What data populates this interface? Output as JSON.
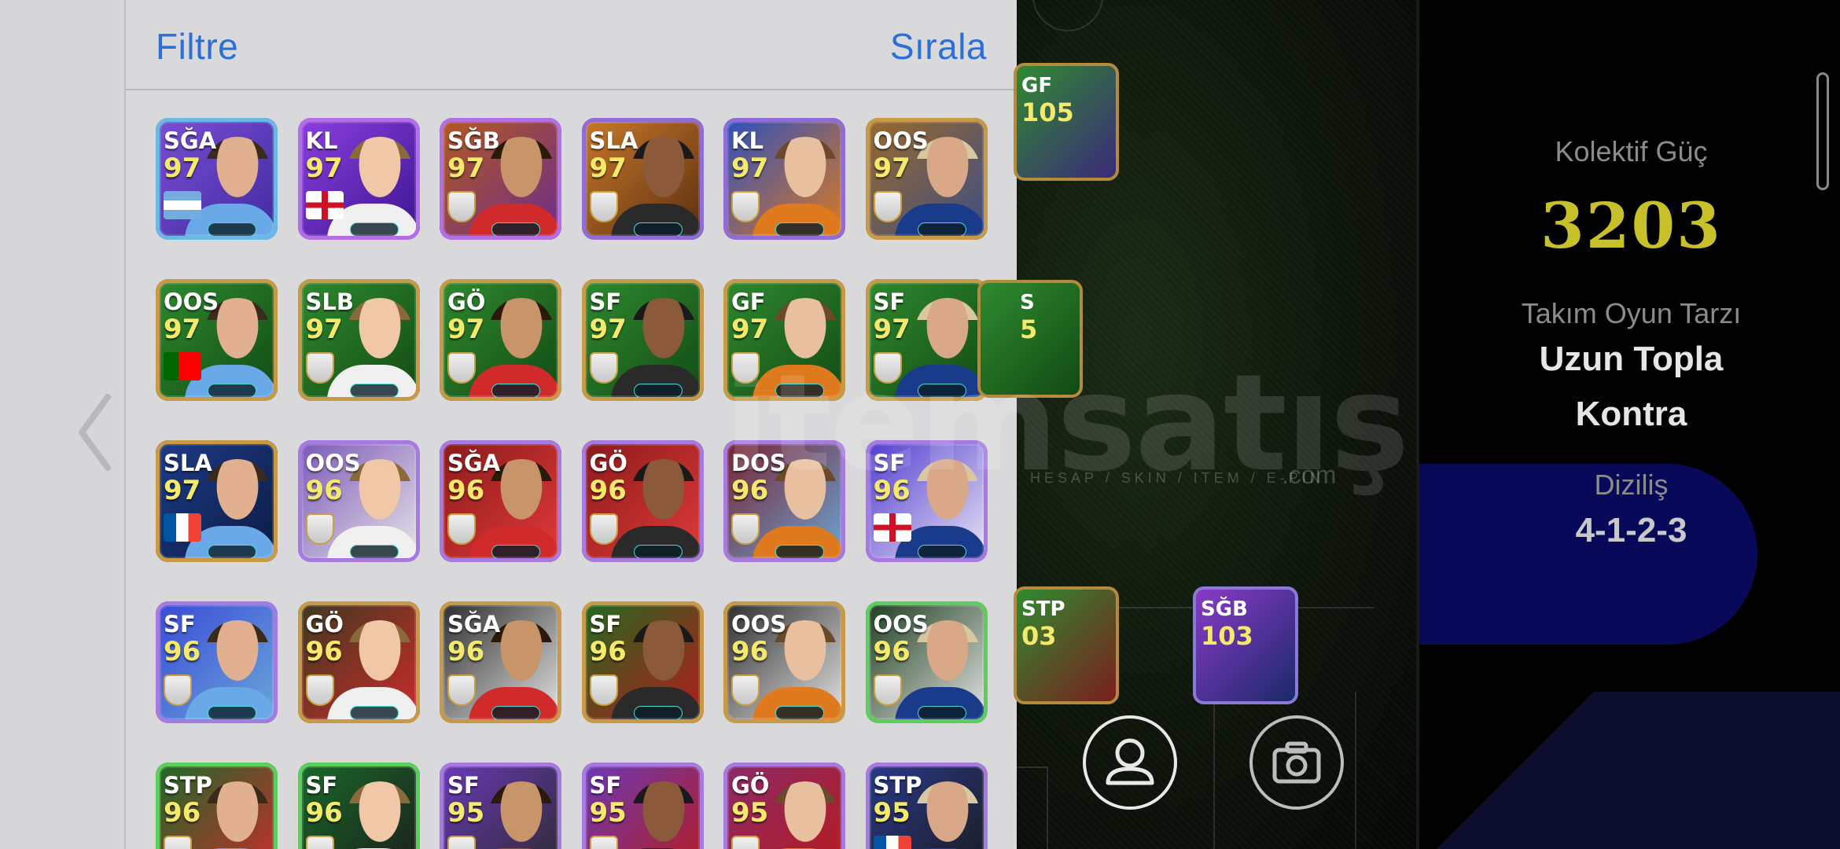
{
  "panel": {
    "filter_label": "Filtre",
    "sort_label": "Sırala"
  },
  "cards": [
    {
      "pos": "SĞA",
      "rating": "97",
      "rim": "#69b8e6",
      "bg": "linear-gradient(135deg,#7a4fd6,#3f2a9e)",
      "badge": "argentina-flag-icon"
    },
    {
      "pos": "KL",
      "rating": "97",
      "rim": "#b46fe8",
      "bg": "linear-gradient(135deg,#8d3fe0,#3b1590)",
      "badge": "england-flag-icon"
    },
    {
      "pos": "SĞB",
      "rating": "97",
      "rim": "#b46fe8",
      "bg": "linear-gradient(135deg,#b55a20,#6b2c8c)",
      "badge": "arsenal-crest-icon"
    },
    {
      "pos": "SLA",
      "rating": "97",
      "rim": "#8f6cd8",
      "bg": "linear-gradient(135deg,#c97b2a,#5a2c10)",
      "badge": "real-madrid-crest-icon"
    },
    {
      "pos": "KL",
      "rating": "97",
      "rim": "#8f6cd8",
      "bg": "linear-gradient(135deg,#2a4fc0,#e07a1e)",
      "badge": "real-madrid-crest-icon"
    },
    {
      "pos": "OOS",
      "rating": "97",
      "rim": "#c89a45",
      "bg": "linear-gradient(135deg,#9b6a28,#3b4d88)",
      "badge": "chelsea-crest-icon"
    },
    {
      "pos": "OOS",
      "rating": "97",
      "rim": "#c89a45",
      "bg": "linear-gradient(135deg,#2f8a2f,#124a14)",
      "badge": "portugal-flag-icon"
    },
    {
      "pos": "SLB",
      "rating": "97",
      "rim": "#c89a45",
      "bg": "linear-gradient(135deg,#2f8a2f,#124a14)",
      "badge": "manchester-united-crest-icon"
    },
    {
      "pos": "GÖ",
      "rating": "97",
      "rim": "#c89a45",
      "bg": "linear-gradient(135deg,#2f8a2f,#124a14)",
      "badge": "la-galaxy-crest-icon"
    },
    {
      "pos": "SF",
      "rating": "97",
      "rim": "#c89a45",
      "bg": "linear-gradient(135deg,#2f8a2f,#124a14)",
      "badge": "barcelona-crest-icon"
    },
    {
      "pos": "GF",
      "rating": "97",
      "rim": "#c89a45",
      "bg": "linear-gradient(135deg,#2f8a2f,#124a14)",
      "badge": "barcelona-crest-icon"
    },
    {
      "pos": "SF",
      "rating": "97",
      "rim": "#c89a45",
      "bg": "linear-gradient(135deg,#2f8a2f,#124a14)",
      "badge": "manchester-united-crest-icon"
    },
    {
      "pos": "SLA",
      "rating": "97",
      "rim": "#c89a45",
      "bg": "linear-gradient(135deg,#1e3c8a,#0b1a40)",
      "badge": "france-flag-icon"
    },
    {
      "pos": "OOS",
      "rating": "96",
      "rim": "#a67ae0",
      "bg": "linear-gradient(135deg,#7a55b8,#e8e8e8)",
      "badge": "besiktas-crest-icon"
    },
    {
      "pos": "SĞA",
      "rating": "96",
      "rim": "#a67ae0",
      "bg": "linear-gradient(135deg,#8a1a1a,#e23a3a)",
      "badge": "arsenal-crest-icon"
    },
    {
      "pos": "GÖ",
      "rating": "96",
      "rim": "#a67ae0",
      "bg": "linear-gradient(135deg,#8a1a1a,#e23a3a)",
      "badge": "arsenal-crest-icon"
    },
    {
      "pos": "DOS",
      "rating": "96",
      "rim": "#a67ae0",
      "bg": "linear-gradient(135deg,#7a1f2f,#6aa9d8)",
      "badge": "manchester-city-crest-icon"
    },
    {
      "pos": "SF",
      "rating": "96",
      "rim": "#a67ae0",
      "bg": "linear-gradient(135deg,#4e3ad0,#ece8f4)",
      "badge": "england-flag-icon"
    },
    {
      "pos": "SF",
      "rating": "96",
      "rim": "#a67ae0",
      "bg": "linear-gradient(135deg,#3a48d8,#6aa9d8)",
      "badge": "manchester-city-crest-icon"
    },
    {
      "pos": "GÖ",
      "rating": "96",
      "rim": "#c89a45",
      "bg": "linear-gradient(135deg,#3a3a20,#d02a2a)",
      "badge": "arsenal-crest-icon"
    },
    {
      "pos": "SĞA",
      "rating": "96",
      "rim": "#c89a45",
      "bg": "linear-gradient(135deg,#2a2a2a,#e8e8e8)",
      "badge": "real-madrid-crest-icon"
    },
    {
      "pos": "SF",
      "rating": "96",
      "rim": "#c89a45",
      "bg": "linear-gradient(135deg,#1f6a1f,#b81a1a)",
      "badge": "ac-milan-crest-icon"
    },
    {
      "pos": "OOS",
      "rating": "96",
      "rim": "#c89a45",
      "bg": "linear-gradient(135deg,#2a2a2a,#e8e8e8)",
      "badge": "real-madrid-crest-icon"
    },
    {
      "pos": "OOS",
      "rating": "96",
      "rim": "#5ad05a",
      "bg": "linear-gradient(135deg,#1a3a1a,#e8e8e8)",
      "badge": "real-madrid-crest-icon"
    },
    {
      "pos": "STP",
      "rating": "96",
      "rim": "#5ad05a",
      "bg": "linear-gradient(135deg,#1a6a2a,#d02a2a)",
      "badge": "liverpool-crest-icon"
    },
    {
      "pos": "SF",
      "rating": "96",
      "rim": "#5ad05a",
      "bg": "linear-gradient(135deg,#1a6a2a,#1a1a1a)",
      "badge": "real-madrid-crest-icon"
    },
    {
      "pos": "SF",
      "rating": "95",
      "rim": "#a67ae0",
      "bg": "linear-gradient(135deg,#6a3ab8,#2a2a2a)",
      "badge": "boca-crest-icon"
    },
    {
      "pos": "SF",
      "rating": "95",
      "rim": "#a67ae0",
      "bg": "linear-gradient(135deg,#6a3ab8,#b81a1a)",
      "badge": "ac-milan-crest-icon"
    },
    {
      "pos": "GÖ",
      "rating": "95",
      "rim": "#a67ae0",
      "bg": "linear-gradient(135deg,#8a2a6a,#b81a1a)",
      "badge": "barcelona-crest-icon"
    },
    {
      "pos": "STP",
      "rating": "95",
      "rim": "#a67ae0",
      "bg": "linear-gradient(135deg,#2a3a8a,#1a1a1a)",
      "badge": "france-flag-icon"
    }
  ],
  "field_cards": [
    {
      "pos": "GF",
      "rating": "105"
    },
    {
      "pos": "S",
      "rating": "5"
    },
    {
      "pos": "STP",
      "rating": "03"
    },
    {
      "pos": "SĞB",
      "rating": "103"
    }
  ],
  "stats": {
    "collective_label": "Kolektif Güç",
    "collective_value": "3203",
    "style_label": "Takım Oyun Tarzı",
    "style_value_line1": "Uzun Topla",
    "style_value_line2": "Kontra",
    "formation_label": "Diziliş",
    "formation_value": "4-1-2-3"
  },
  "watermark": {
    "text": "itemsatış",
    "sub": "HESAP / SKIN / ITEM / E-PIN",
    "com": ".com"
  },
  "colors": {
    "accent_blue": "#2c6fd6",
    "rating_yellow": "#f4e96a",
    "collective_gold": "#c8c02a",
    "stat_white": "#e6e6e6"
  }
}
